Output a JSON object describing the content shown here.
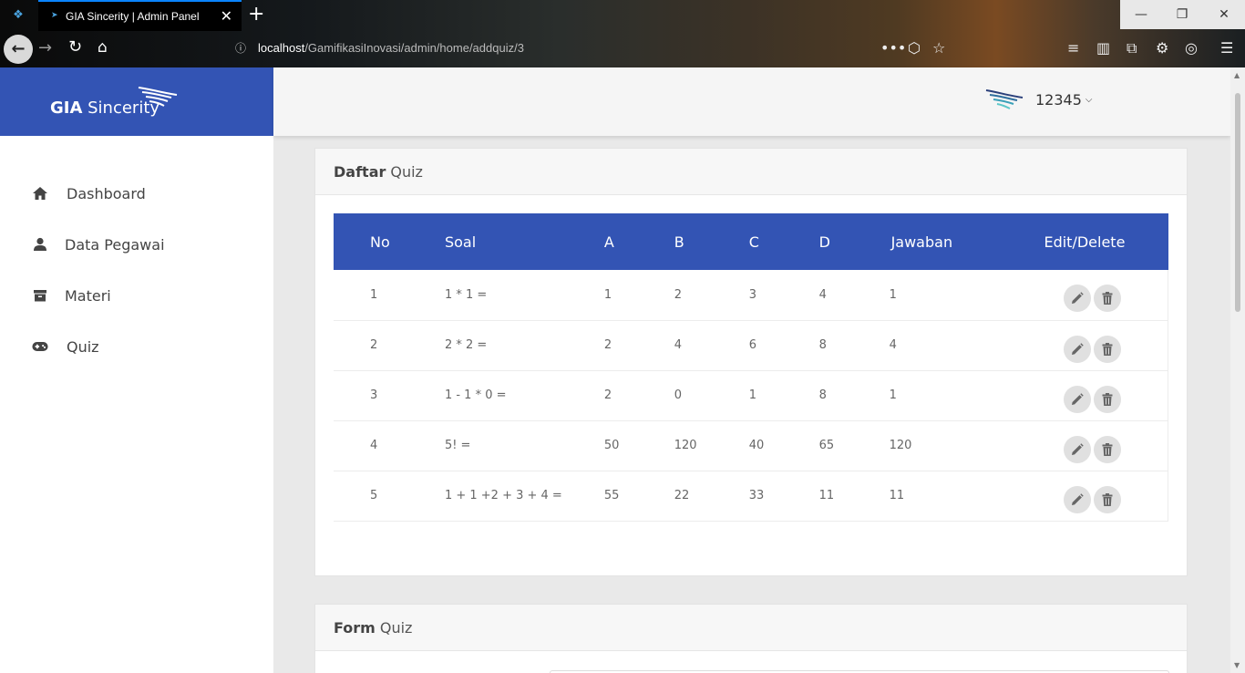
{
  "browser": {
    "tab_title": "GIA Sincerity | Admin Panel",
    "url_host": "localhost",
    "url_path": "/GamifikasiInovasi/admin/home/addquiz/3"
  },
  "sidebar": {
    "brand_bold": "GIA",
    "brand_rest": " Sincerity",
    "items": [
      {
        "label": "Dashboard",
        "icon": "home-icon"
      },
      {
        "label": "Data Pegawai",
        "icon": "user-icon"
      },
      {
        "label": "Materi",
        "icon": "archive-icon"
      },
      {
        "label": "Quiz",
        "icon": "gamepad-icon"
      }
    ]
  },
  "topbar": {
    "username": "12345"
  },
  "quiz_card": {
    "title_bold": "Daftar",
    "title_rest": "Quiz",
    "columns": [
      "No",
      "Soal",
      "A",
      "B",
      "C",
      "D",
      "Jawaban",
      "Edit/Delete"
    ],
    "rows": [
      {
        "no": "1",
        "soal": "1 * 1 =",
        "a": "1",
        "b": "2",
        "c": "3",
        "d": "4",
        "jawaban": "1"
      },
      {
        "no": "2",
        "soal": "2 * 2 =",
        "a": "2",
        "b": "4",
        "c": "6",
        "d": "8",
        "jawaban": "4"
      },
      {
        "no": "3",
        "soal": "1 - 1 * 0 =",
        "a": "2",
        "b": "0",
        "c": "1",
        "d": "8",
        "jawaban": "1"
      },
      {
        "no": "4",
        "soal": "5! =",
        "a": "50",
        "b": "120",
        "c": "40",
        "d": "65",
        "jawaban": "120"
      },
      {
        "no": "5",
        "soal": "1 + 1 +2 + 3 + 4 =",
        "a": "55",
        "b": "22",
        "c": "33",
        "d": "11",
        "jawaban": "11"
      }
    ]
  },
  "form_card": {
    "title_bold": "Form",
    "title_rest": "Quiz"
  },
  "colors": {
    "primary": "#3354b4",
    "sidebar_bg": "#ffffff",
    "content_bg": "#e9e9e9"
  }
}
